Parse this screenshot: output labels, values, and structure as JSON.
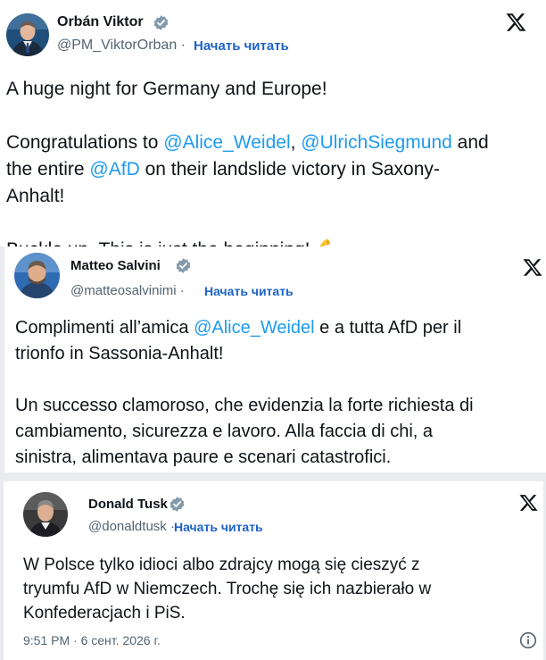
{
  "tweets": [
    {
      "name": "Orbán Viktor",
      "handle": "@PM_ViktorOrban",
      "separator": "·",
      "follow_label": "Начать читать",
      "body": [
        [
          "A huge night for Germany and Europe!"
        ],
        [],
        [
          "Congratulations to ",
          "@Alice_Weidel",
          ", ",
          "@UlrichSiegmund",
          " and"
        ],
        [
          "the entire ",
          "@AfD",
          " on their landslide victory in Saxony-"
        ],
        [
          "Anhalt!"
        ],
        [],
        [
          "Buckle up. This is just the beginning!  ",
          "💪"
        ]
      ]
    },
    {
      "name": "Matteo Salvini",
      "handle": "@matteosalvinimi",
      "separator": "·",
      "follow_label": "Начать читать",
      "body": [
        [
          "Complimenti all’amica ",
          "@Alice_Weidel",
          " e a tutta AfD per il"
        ],
        [
          "trionfo in Sassonia-Anhalt!"
        ],
        [],
        [
          "Un successo clamoroso, che evidenzia la forte richiesta di"
        ],
        [
          "cambiamento, sicurezza e lavoro. Alla faccia di chi, a"
        ],
        [
          "sinistra, alimentava paure e scenari catastrofici."
        ]
      ]
    },
    {
      "name": "Donald Tusk",
      "handle": "@donaldtusk",
      "separator": "·",
      "follow_label": "Начать читать",
      "body": [
        [
          "W Polsce tylko idioci albo zdrajcy mogą się cieszyć z"
        ],
        [
          "tryumfu AfD w Niemczech. Trochę się ich  nazbierało  w"
        ],
        [
          "Konfederacjach i PiS."
        ]
      ],
      "timestamp": "9:51 PM · 6 сент. 2026 г."
    }
  ],
  "colors": {
    "link": "#1d9bf0",
    "follow": "#1d63c9",
    "verified": "#829aab",
    "muted": "#536471"
  },
  "icons": {
    "verified": "verified-badge-icon",
    "x_logo": "x-logo-icon",
    "info": "info-icon"
  }
}
